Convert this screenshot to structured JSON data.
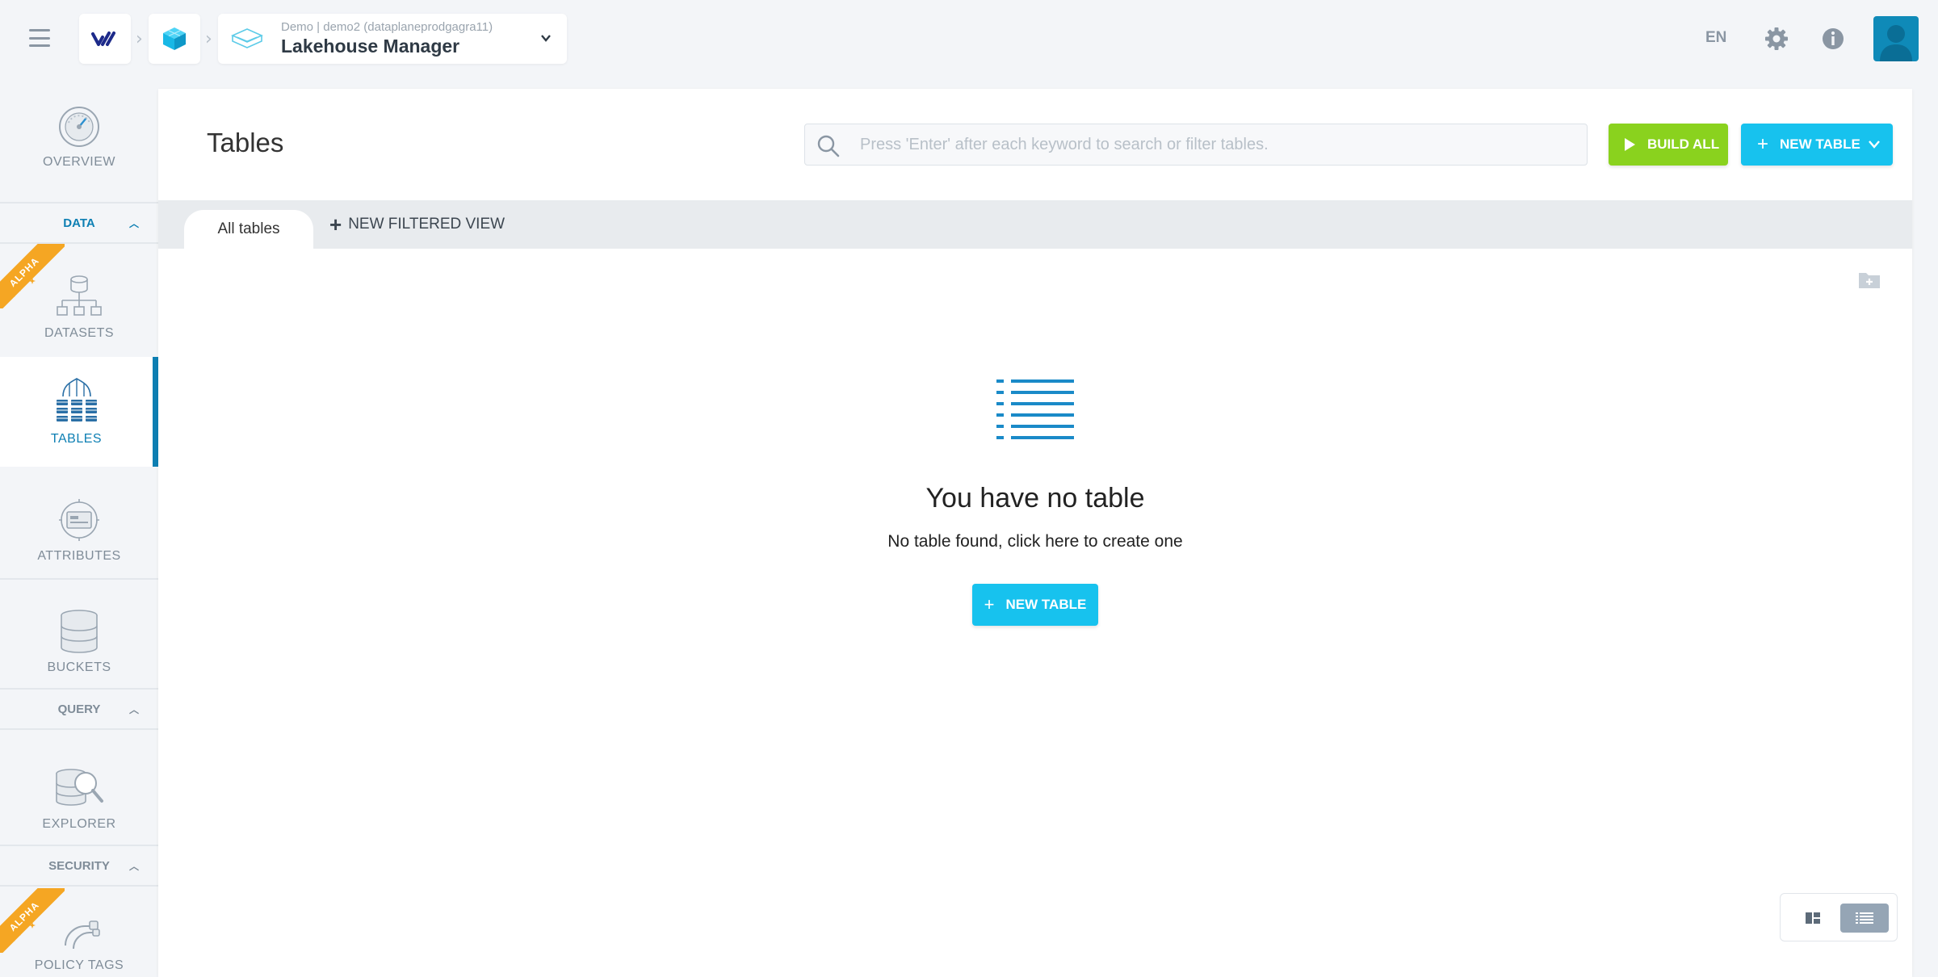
{
  "breadcrumb": {
    "app_sub": "Demo | demo2 (dataplaneprodgagra11)",
    "app_title": "Lakehouse Manager"
  },
  "header": {
    "language": "EN",
    "icons": [
      "settings-gear-icon",
      "info-icon",
      "user-avatar"
    ]
  },
  "sidebar": {
    "items": [
      {
        "id": "overview",
        "label": "OVERVIEW",
        "icon": "gauge-icon"
      },
      {
        "id": "datasets",
        "label": "DATASETS",
        "icon": "dataset-tree-icon",
        "badge": "ALPHA"
      },
      {
        "id": "tables",
        "label": "TABLES",
        "icon": "tables-icon",
        "active": true
      },
      {
        "id": "attributes",
        "label": "ATTRIBUTES",
        "icon": "attributes-icon"
      },
      {
        "id": "buckets",
        "label": "BUCKETS",
        "icon": "bucket-icon"
      },
      {
        "id": "explorer",
        "label": "EXPLORER",
        "icon": "explorer-icon"
      },
      {
        "id": "policy_tags",
        "label": "POLICY TAGS",
        "icon": "policy-tags-icon",
        "badge": "ALPHA"
      }
    ],
    "sections": {
      "data": "DATA",
      "query": "QUERY",
      "security": "SECURITY"
    }
  },
  "main": {
    "title": "Tables",
    "search_placeholder": "Press 'Enter' after each keyword to search or filter tables.",
    "build_all_label": "BUILD ALL",
    "new_table_label": "NEW TABLE",
    "tabs": {
      "all_tables": "All tables",
      "new_filtered_view": "NEW FILTERED VIEW"
    },
    "empty": {
      "title": "You have no table",
      "subtitle": "No table found, click here to create one",
      "button": "NEW TABLE"
    }
  },
  "colors": {
    "accent": "#0d7fb3",
    "build_green": "#8ad21e",
    "new_cyan": "#17c2ee",
    "alpha_orange": "#f5a623"
  }
}
